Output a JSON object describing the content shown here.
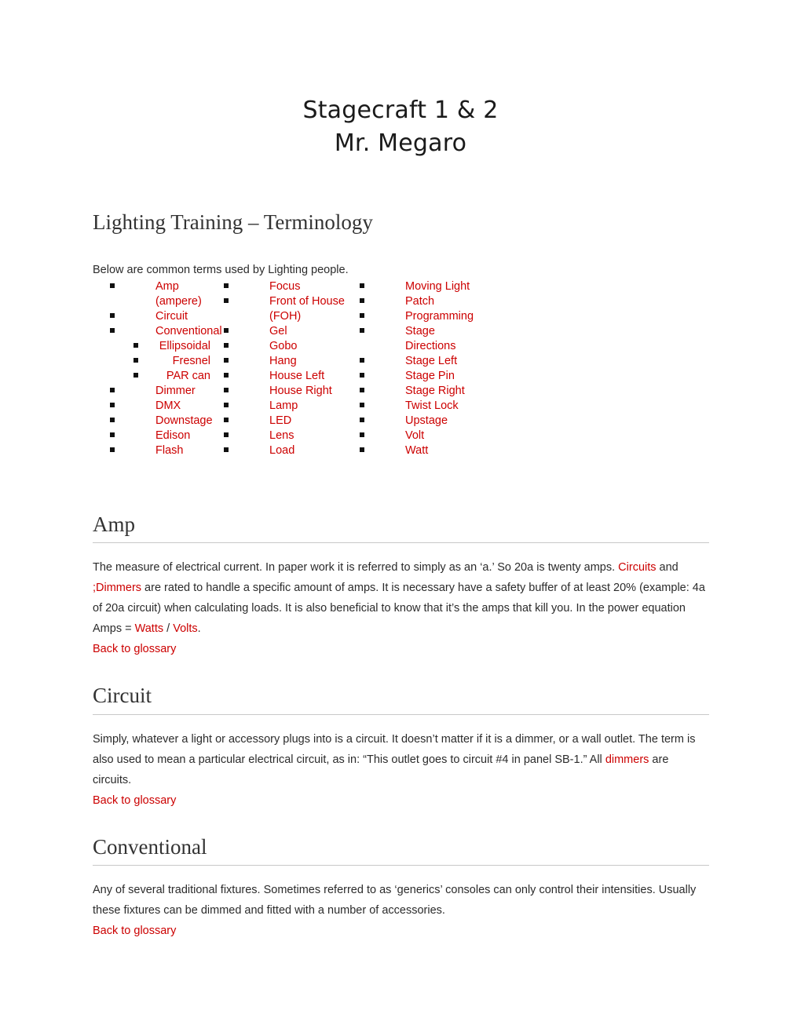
{
  "title": {
    "line1": "Stagecraft 1 & 2",
    "line2": "Mr. Megaro"
  },
  "section_heading": "Lighting Training – Terminology",
  "intro": "Below are common terms used by Lighting people.",
  "colors": {
    "link_red": "#cc0000",
    "body_text": "#2b2b2b",
    "heading": "#333333",
    "rule": "#c8c8c8"
  },
  "glossary": {
    "column1": [
      {
        "label": "Amp (ampere)",
        "level": 1
      },
      {
        "label": "Circuit",
        "level": 1
      },
      {
        "label": "Conventional",
        "level": 1
      },
      {
        "label": "Ellipsoidal",
        "level": 2
      },
      {
        "label": "Fresnel",
        "level": 2
      },
      {
        "label": "PAR can",
        "level": 2
      },
      {
        "label": "Dimmer",
        "level": 1
      },
      {
        "label": "DMX",
        "level": 1
      },
      {
        "label": "Downstage",
        "level": 1
      },
      {
        "label": "Edison",
        "level": 1
      },
      {
        "label": "Flash",
        "level": 1
      }
    ],
    "column2": [
      {
        "label": "Focus",
        "level": 1
      },
      {
        "label": "Front of House (FOH)",
        "level": 1
      },
      {
        "label": "Gel",
        "level": 1
      },
      {
        "label": "Gobo",
        "level": 1
      },
      {
        "label": "Hang",
        "level": 1
      },
      {
        "label": "House Left",
        "level": 1
      },
      {
        "label": "House Right",
        "level": 1
      },
      {
        "label": "Lamp",
        "level": 1
      },
      {
        "label": "LED",
        "level": 1
      },
      {
        "label": "Lens",
        "level": 1
      },
      {
        "label": "Load",
        "level": 1
      }
    ],
    "column3": [
      {
        "label": "Moving Light",
        "level": 1
      },
      {
        "label": "Patch",
        "level": 1
      },
      {
        "label": "Programming",
        "level": 1
      },
      {
        "label": "Stage Directions",
        "level": 1
      },
      {
        "label": "Stage Left",
        "level": 1
      },
      {
        "label": "Stage Pin",
        "level": 1
      },
      {
        "label": "Stage Right",
        "level": 1
      },
      {
        "label": "Twist Lock",
        "level": 1
      },
      {
        "label": "Upstage",
        "level": 1
      },
      {
        "label": "Volt",
        "level": 1
      },
      {
        "label": "Watt",
        "level": 1
      }
    ]
  },
  "terms": [
    {
      "heading": "Amp",
      "paragraph_runs": [
        {
          "text": "The measure of electrical current. In paper work it is referred to simply as an ‘a.’ So 20a is twenty amps. ",
          "link": false
        },
        {
          "text": "Circuits",
          "link": true
        },
        {
          "text": " and ",
          "link": false
        },
        {
          "text": ";Dimmers",
          "link": true
        },
        {
          "text": " are rated to handle a specific amount of amps. It is necessary have a safety buffer of at least 20% (example: 4a of 20a circuit) when calculating loads. It is also beneficial to know that it’s the amps that kill you. In the power equation Amps = ",
          "link": false
        },
        {
          "text": "Watts",
          "link": true
        },
        {
          "text": " / ",
          "link": false
        },
        {
          "text": "Volts",
          "link": true
        },
        {
          "text": ".",
          "link": false
        }
      ],
      "back_link": "Back to glossary"
    },
    {
      "heading": "Circuit",
      "paragraph_runs": [
        {
          "text": "Simply, whatever a light or accessory plugs into is a circuit. It doesn’t matter if it is a dimmer, or a wall outlet. The term is also used to mean a particular electrical circuit, as in: “This outlet goes to circuit #4 in panel SB-1.” All ",
          "link": false
        },
        {
          "text": "dimmers",
          "link": true
        },
        {
          "text": " are circuits.",
          "link": false
        }
      ],
      "back_link": "Back to glossary"
    },
    {
      "heading": "Conventional",
      "paragraph_runs": [
        {
          "text": "Any of several traditional fixtures. Sometimes referred to as ‘generics’ consoles can only control their intensities. Usually these fixtures can be dimmed and fitted with a number of accessories.",
          "link": false
        }
      ],
      "back_link": "Back to glossary"
    }
  ]
}
